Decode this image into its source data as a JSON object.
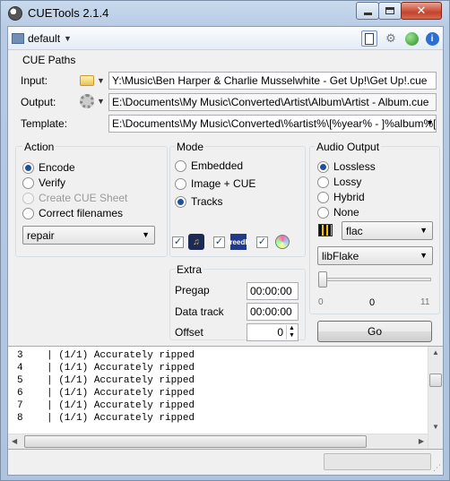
{
  "window": {
    "title": "CUETools 2.1.4"
  },
  "toolbar": {
    "profile": "default"
  },
  "cue_paths": {
    "title": "CUE Paths",
    "input_label": "Input:",
    "input_value": "Y:\\Music\\Ben Harper & Charlie Musselwhite - Get Up!\\Get Up!.cue",
    "output_label": "Output:",
    "output_value": "E:\\Documents\\My Music\\Converted\\Artist\\Album\\Artist - Album.cue",
    "template_label": "Template:",
    "template_value": "E:\\Documents\\My Music\\Converted\\%artist%\\[%year% - ]%album%["
  },
  "action": {
    "title": "Action",
    "options": [
      "Encode",
      "Verify",
      "Create CUE Sheet",
      "Correct filenames"
    ],
    "selected": "Encode",
    "disabled": "Create CUE Sheet",
    "mode_select": "repair"
  },
  "mode": {
    "title": "Mode",
    "options": [
      "Embedded",
      "Image + CUE",
      "Tracks"
    ],
    "selected": "Tracks",
    "freedb_label": "freedb"
  },
  "extra": {
    "title": "Extra",
    "pregap_label": "Pregap",
    "pregap_value": "00:00:00",
    "datatrack_label": "Data track",
    "datatrack_value": "00:00:00",
    "offset_label": "Offset",
    "offset_value": "0"
  },
  "audio_output": {
    "title": "Audio Output",
    "options": [
      "Lossless",
      "Lossy",
      "Hybrid",
      "None"
    ],
    "selected": "Lossless",
    "format": "flac",
    "encoder": "libFlake",
    "slider_min": "0",
    "slider_value": "0",
    "slider_max": "11",
    "go_label": "Go"
  },
  "log": {
    "lines": [
      "3    | (1/1) Accurately ripped",
      "4    | (1/1) Accurately ripped",
      "5    | (1/1) Accurately ripped",
      "6    | (1/1) Accurately ripped",
      "7    | (1/1) Accurately ripped",
      "8    | (1/1) Accurately ripped"
    ]
  }
}
